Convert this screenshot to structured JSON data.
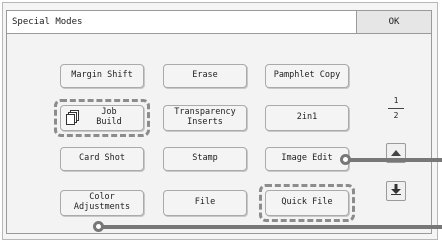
{
  "title": "Special Modes",
  "ok_label": "OK",
  "buttons": {
    "margin_shift": "Margin Shift",
    "erase": "Erase",
    "pamphlet_copy": "Pamphlet Copy",
    "job_build_line1": "Job",
    "job_build_line2": "Build",
    "transparency_line1": "Transparency",
    "transparency_line2": "Inserts",
    "two_in_one": "2in1",
    "card_shot": "Card Shot",
    "stamp": "Stamp",
    "image_edit": "Image Edit",
    "color_adj_line1": "Color",
    "color_adj_line2": "Adjustments",
    "file": "File",
    "quick_file": "Quick File"
  },
  "pagination": {
    "current": "1",
    "total": "2"
  },
  "icons": {
    "job_build_icon": "copy-stack-icon",
    "scroll_up": "scroll-up-icon",
    "scroll_down": "scroll-down-icon"
  },
  "colors": {
    "highlight_border": "#8c8c8c",
    "callout": "#777777"
  }
}
